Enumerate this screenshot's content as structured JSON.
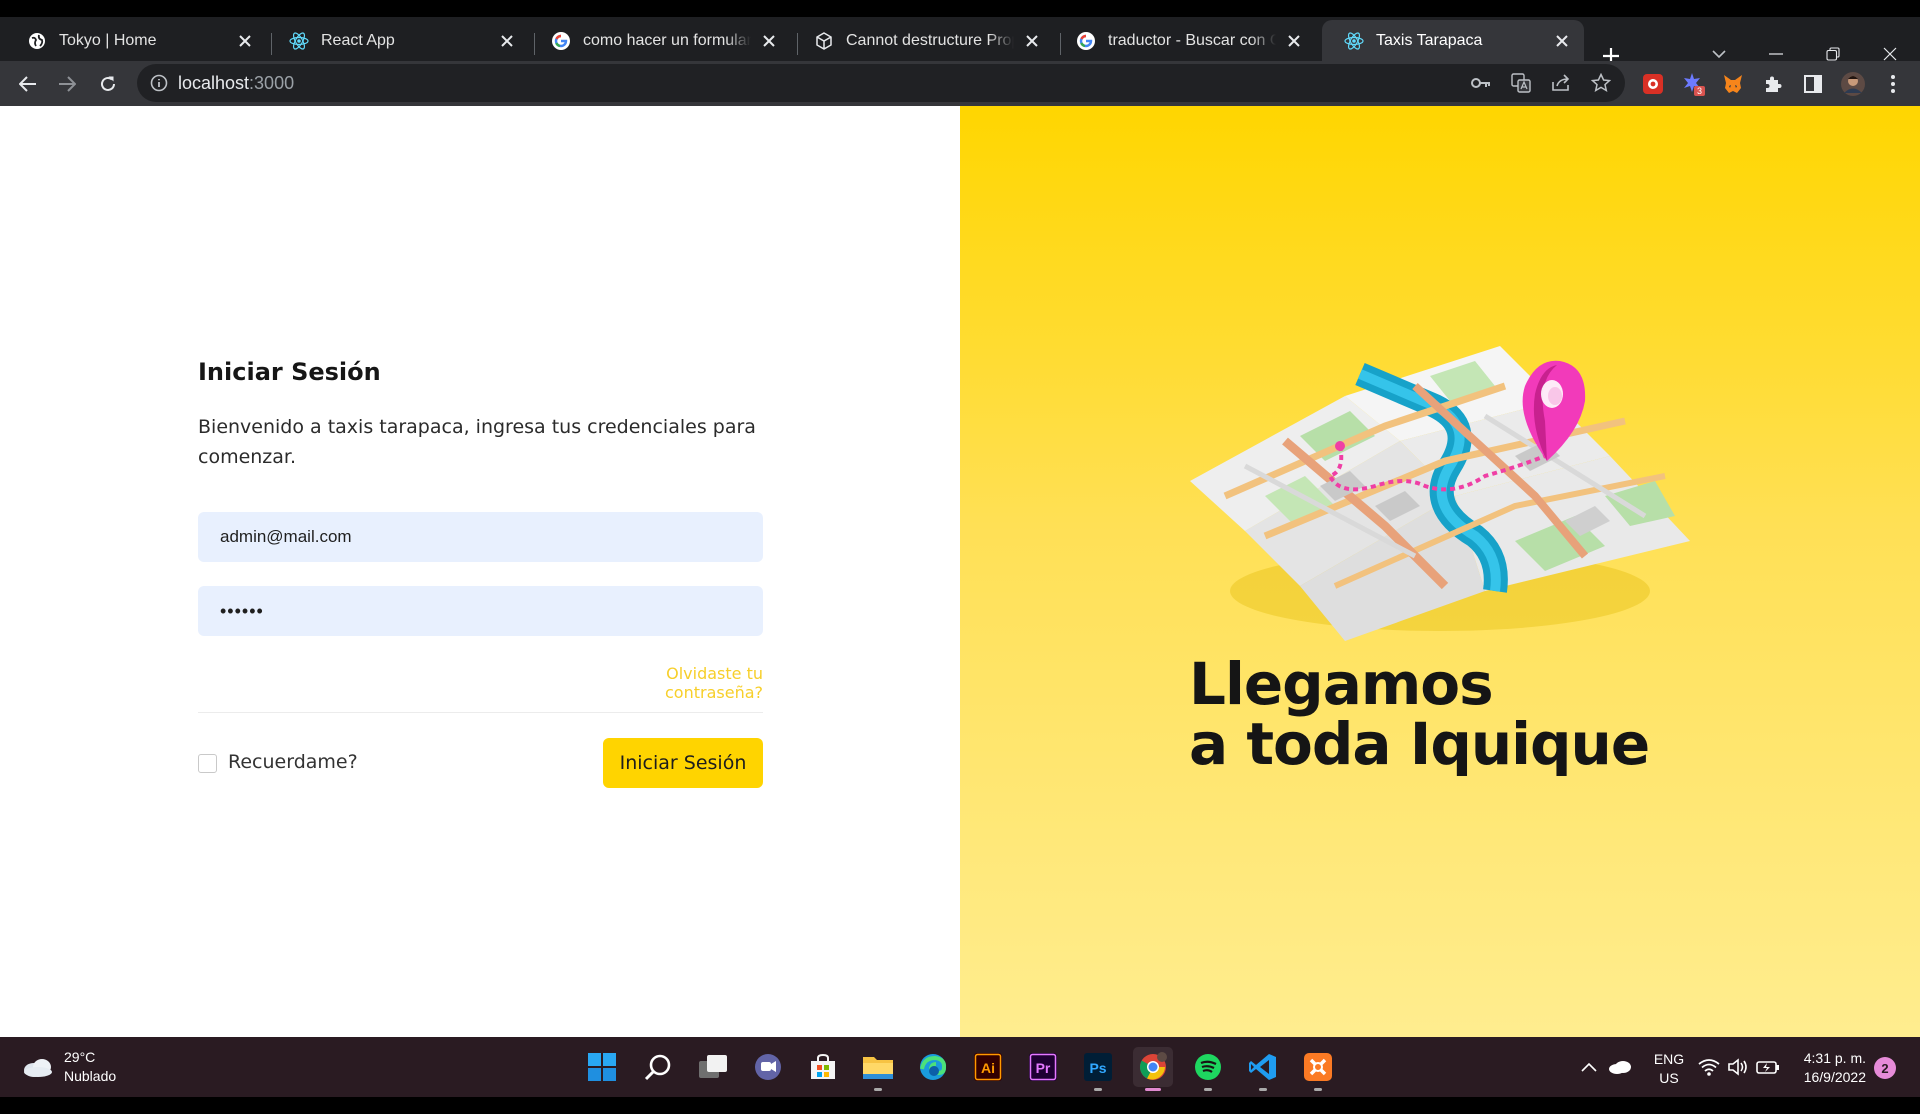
{
  "browser": {
    "tabs": [
      {
        "title": "Tokyo | Home",
        "icon": "globe-icon"
      },
      {
        "title": "React App",
        "icon": "react-icon"
      },
      {
        "title": "como hacer un formulario c",
        "icon": "google-icon"
      },
      {
        "title": "Cannot destructure Propert",
        "icon": "cube-icon"
      },
      {
        "title": "traductor - Buscar con Goo",
        "icon": "google-icon"
      },
      {
        "title": "Taxis Tarapaca",
        "icon": "react-icon",
        "active": true
      }
    ],
    "address": {
      "host": "localhost",
      "port": ":3000"
    },
    "extension_badge": "3"
  },
  "login": {
    "title": "Iniciar Sesión",
    "description": "Bienvenido a taxis tarapaca, ingresa tus credenciales para comenzar.",
    "email_value": "admin@mail.com",
    "password_value": "••••••",
    "forgot_link": "Olvidaste tu contraseña?",
    "remember_label": "Recuerdame?",
    "submit_label": "Iniciar Sesión"
  },
  "hero": {
    "line1": "Llegamos",
    "line2": "a toda Iquique"
  },
  "taskbar": {
    "weather_temp": "29°C",
    "weather_desc": "Nublado",
    "lang_line1": "ENG",
    "lang_line2": "US",
    "time": "4:31 p. m.",
    "date": "16/9/2022",
    "notifications": "2"
  },
  "colors": {
    "accent_yellow": "#ffd400",
    "link_yellow": "#f7cf2a",
    "input_bg": "#e8f0fe"
  }
}
